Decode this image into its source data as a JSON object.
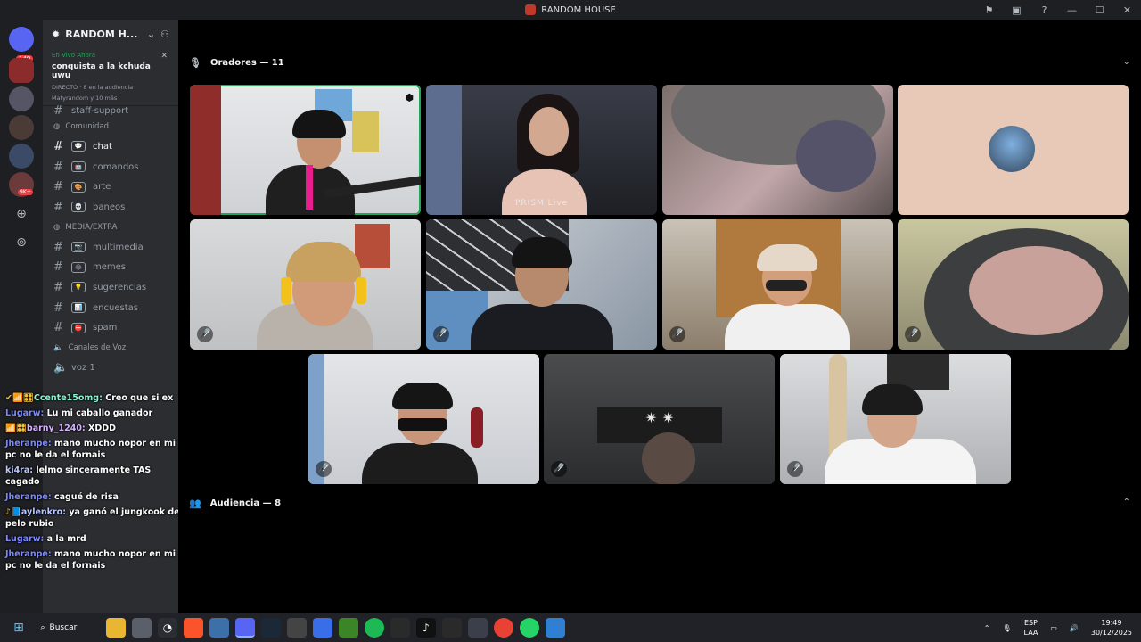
{
  "window": {
    "title": "RANDOM HOUSE"
  },
  "servers": {
    "badge_top": "149",
    "badge_other": "9K+"
  },
  "sidebar": {
    "server_name": "RANDOM H...",
    "live": {
      "tag": "En Vivo Ahora",
      "title": "conquista a la kchuda uwu",
      "meta": "DIRECTO · 8 en la audiencia",
      "viewers": "Matyrandom y 10 más"
    },
    "top_channel": "staff-support",
    "categories": {
      "community": "Comunidad",
      "media": "MEDIA/EXTRA",
      "voice": "Canales de Voz"
    },
    "community_channels": [
      {
        "emo": "💬",
        "label": "chat",
        "active": true
      },
      {
        "emo": "🤖",
        "label": "comandos"
      },
      {
        "emo": "🎨",
        "label": "arte"
      },
      {
        "emo": "💀",
        "label": "baneos"
      }
    ],
    "media_channels": [
      {
        "emo": "📷",
        "label": "multimedia"
      },
      {
        "emo": "😂",
        "label": "memes"
      },
      {
        "emo": "💡",
        "label": "sugerencias"
      },
      {
        "emo": "📊",
        "label": "encuestas"
      },
      {
        "emo": "⛔",
        "label": "spam"
      }
    ],
    "voice_channel": "voz 1"
  },
  "chat_overlay": [
    {
      "user": "Ccente15omg:",
      "text": "Creo que si ex",
      "style": "teal",
      "badges": "✔📶🎛"
    },
    {
      "user": "Lugarw:",
      "text": "Lu mi caballo ganador",
      "style": ""
    },
    {
      "user": "barny_1240:",
      "text": "XDDD",
      "style": "pink",
      "badges": "📶🎛"
    },
    {
      "user": "Jheranpe:",
      "text": "mano mucho nopor en mi pc no le da el fornais",
      "style": ""
    },
    {
      "user": "ki4ra:",
      "text": "lelmo sinceramente TAS cagado",
      "style": "gold"
    },
    {
      "user": "Jheranpe:",
      "text": "cagué de risa",
      "style": ""
    },
    {
      "user": "aylenkro:",
      "text": "ya ganó el jungkook de pelo rubio",
      "style": "gold",
      "badges": "♪📘"
    },
    {
      "user": "Lugarw:",
      "text": "a la mrd",
      "style": ""
    },
    {
      "user": "Jheranpe:",
      "text": "mano mucho nopor en mi pc no le da el fornais",
      "style": ""
    }
  ],
  "main": {
    "speakers_label": "Oradores — 11",
    "audience_label": "Audiencia — 8",
    "tile_watermark": "PRISM Live"
  },
  "taskbar": {
    "search_label": "Buscar",
    "lang_line1": "ESP",
    "lang_line2": "LAA",
    "time": "19:49",
    "date": "30/12/2025"
  }
}
